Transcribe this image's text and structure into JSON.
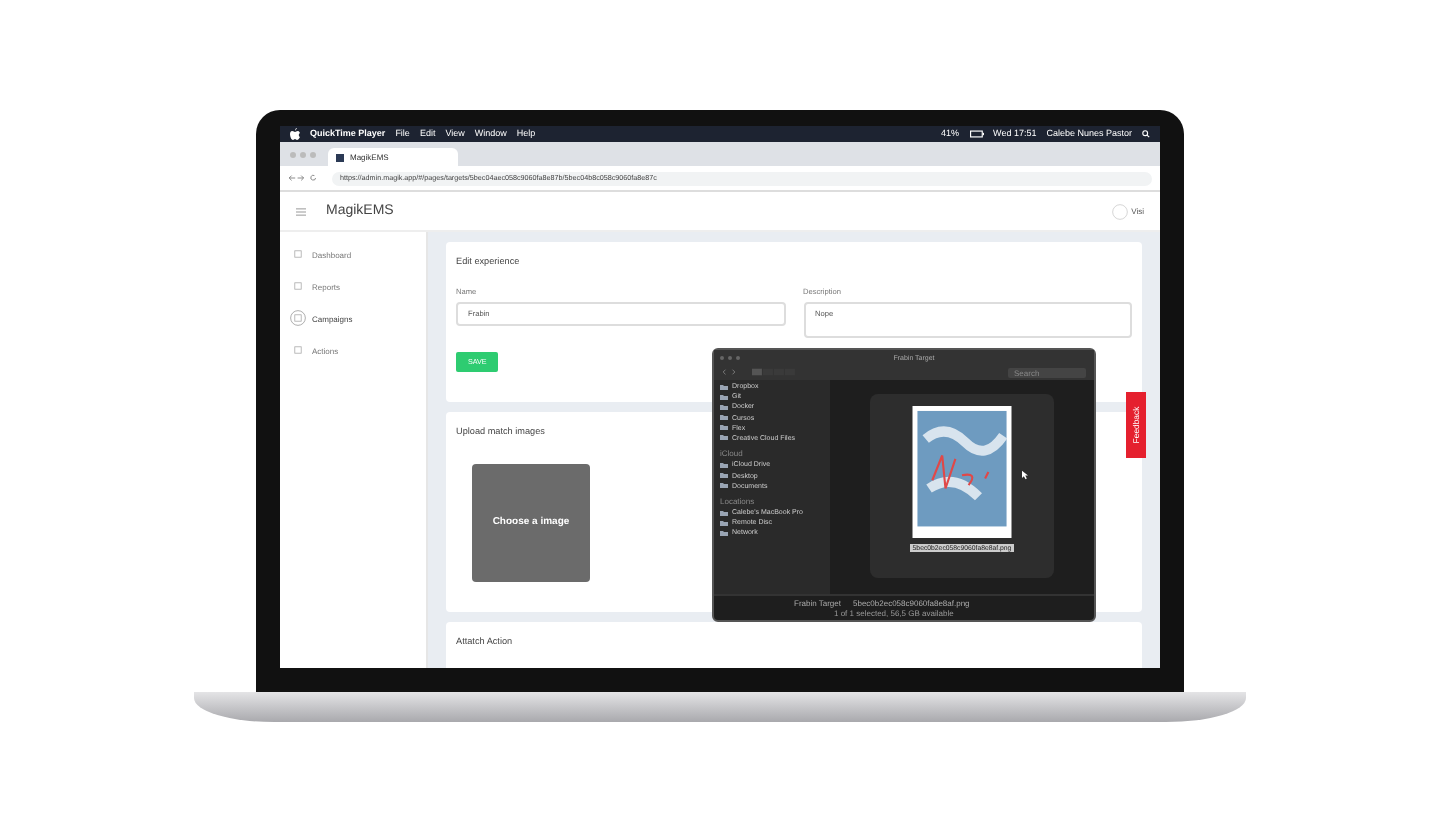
{
  "menu_bar": {
    "app": "QuickTime Player",
    "menus": [
      "File",
      "Edit",
      "View",
      "Window",
      "Help"
    ],
    "battery": "41%",
    "clock": "Wed 17:51",
    "user": "Calebe Nunes Pastor"
  },
  "browser": {
    "tab": "MagikEMS",
    "url": "https://admin.magik.app/#/pages/targets/5bec04aec058c9060fa8e87b/5bec04b8c058c9060fa8e87c"
  },
  "header": {
    "logo": "MagikEMS",
    "user": "Visi"
  },
  "sidebar": {
    "items": [
      {
        "label": "Dashboard",
        "selected": false
      },
      {
        "label": "Reports",
        "selected": false
      },
      {
        "label": "Campaigns",
        "selected": true
      },
      {
        "label": "Actions",
        "selected": false
      }
    ]
  },
  "edit_card": {
    "title": "Edit experience",
    "name_label": "Name",
    "name_value": "Frabin",
    "description_label": "Description",
    "description_value": "Nope",
    "save_button": "SAVE"
  },
  "upload_card": {
    "title": "Upload match images",
    "dropzone": "Choose a image"
  },
  "action_card": {
    "title": "Attatch Action"
  },
  "feedback_tab": "Feedback",
  "finder": {
    "title": "Frabin Target",
    "search_placeholder": "Search",
    "sections": [
      {
        "items": [
          "Dropbox",
          "Git",
          "Docker",
          "Cursos",
          "Flex",
          "Creative Cloud Files"
        ]
      },
      {
        "heading": "iCloud",
        "items": [
          "iCloud Drive",
          "Desktop",
          "Documents"
        ]
      },
      {
        "heading": "Locations",
        "items": [
          "Calebe's MacBook Pro",
          "Remote Disc",
          "Network"
        ]
      }
    ],
    "filename": "5bec0b2ec058c9060fa8e8af.png",
    "path": [
      "Frabin Target",
      "5bec0b2ec058c9060fa8e8af.png"
    ],
    "status": "1 of 1 selected, 56,5 GB available"
  }
}
